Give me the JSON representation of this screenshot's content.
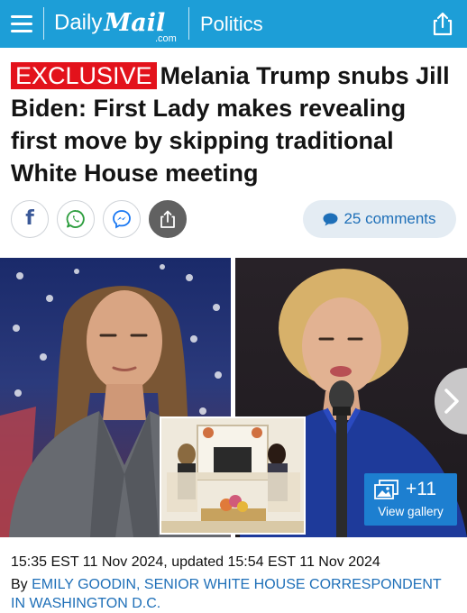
{
  "brand": {
    "daily": "Daily",
    "mail": "Mail",
    "dotcom": ".com",
    "section": "Politics"
  },
  "article": {
    "label": "EXCLUSIVE",
    "headline": "Melania Trump snubs Jill Biden: First Lady makes revealing first move by skipping traditional White House meeting",
    "comments": "25 comments",
    "gallery_count": "+11",
    "gallery_label": "View gallery",
    "dateline": "15:35 EST 11 Nov 2024, updated 15:54 EST 11 Nov 2024",
    "by_prefix": "By ",
    "author": "EMILY GOODIN, SENIOR WHITE HOUSE CORRESPONDENT IN WASHINGTON D.C."
  },
  "icons": {
    "menu": "hamburger-icon",
    "share_top": "share-icon",
    "facebook": "facebook-icon",
    "whatsapp": "whatsapp-icon",
    "messenger": "messenger-icon",
    "share": "share-icon",
    "comment": "comment-bubble-icon",
    "gallery": "image-stack-icon",
    "next": "chevron-right-icon"
  },
  "colors": {
    "topbar": "#1d9ed7",
    "exclusive": "#e3121b",
    "link": "#1e6fb8",
    "gallery": "#1d7fd0",
    "comments_bg": "#e4ecf3"
  }
}
